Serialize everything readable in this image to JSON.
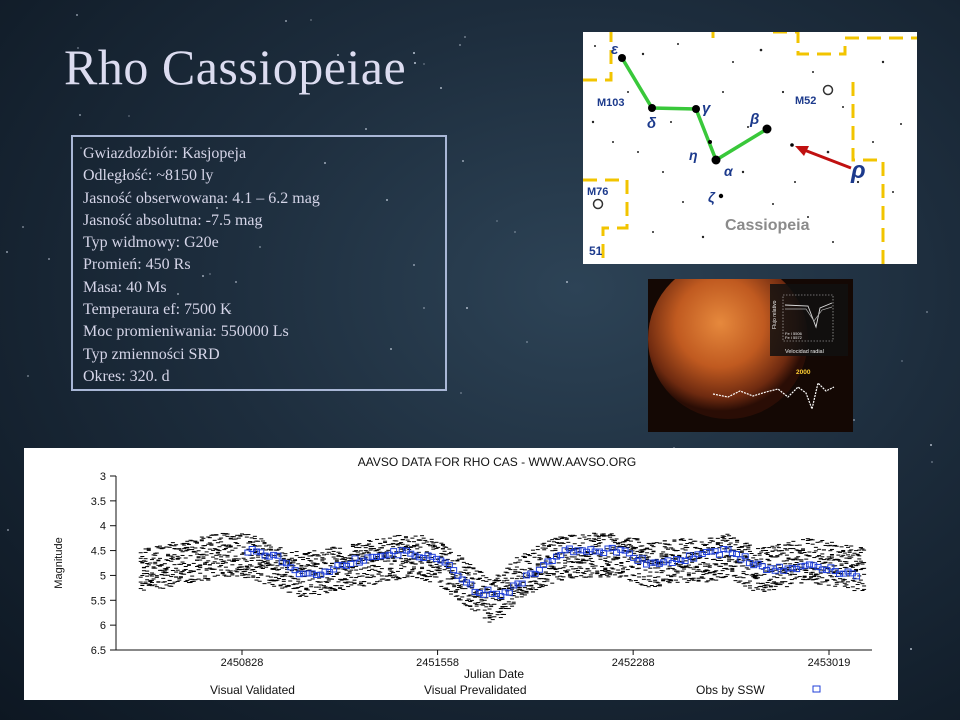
{
  "title": "Rho Cassiopeiae",
  "info_lines": [
    "Gwiazdozbiór: Kasjopeja",
    "Odległość: ~8150 ly",
    "Jasność obserwowana: 4.1 – 6.2 mag",
    "Jasność absolutna: -7.5 mag",
    "Typ widmowy: G20e",
    "Promień: 450 Rs",
    "Masa: 40 Ms",
    "Temperaura ef: 7500 K",
    "Moc promieniwania: 550000 Ls",
    "Typ zmienności SRD",
    "Okres: 320. d"
  ],
  "starmap": {
    "labels": {
      "epsilon": "ε",
      "delta": "δ",
      "gamma": "γ",
      "eta": "η",
      "alpha": "α",
      "zeta": "ζ",
      "beta": "β",
      "rho": "ρ"
    },
    "m103": "M103",
    "m52": "M52",
    "m76": "M76",
    "num51": "51",
    "constellation": "Cassiopeia"
  },
  "photo": {
    "y_label": "Flujo relativo",
    "legend": [
      "Fe I 5506",
      "Fe I 5572"
    ],
    "x_label": "Velocidad radial",
    "year": "2000"
  },
  "lightcurve": {
    "title": "AAVSO DATA FOR RHO CAS - WWW.AAVSO.ORG",
    "ylabel": "Magnitude",
    "xlabel": "Julian Date",
    "yticks": [
      "3",
      "3.5",
      "4",
      "4.5",
      "5",
      "5.5",
      "6",
      "6.5"
    ],
    "xticks": [
      "2450828",
      "2451558",
      "2452288",
      "2453019"
    ],
    "legend": [
      "Visual Validated",
      "Visual Prevalidated",
      "Obs by SSW"
    ],
    "colors": {
      "validated": "#000000",
      "ssw": "#1f3fd8"
    }
  },
  "chart_data": {
    "type": "scatter",
    "title": "AAVSO DATA FOR RHO CAS - WWW.AAVSO.ORG",
    "xlabel": "Julian Date",
    "ylabel": "Magnitude",
    "ylim": [
      6.5,
      3
    ],
    "y_inverted": true,
    "xticks": [
      2450828,
      2451558,
      2452288,
      2453019
    ],
    "series": [
      {
        "name": "Visual Validated",
        "x": [
          2450450,
          2450550,
          2450650,
          2450750,
          2450850,
          2450950,
          2451050,
          2451150,
          2451250,
          2451350,
          2451450,
          2451550,
          2451650,
          2451700,
          2451750,
          2451800,
          2451850,
          2451950,
          2452050,
          2452150,
          2452250,
          2452350,
          2452450,
          2452550,
          2452650,
          2452750,
          2452850,
          2452950,
          2453050,
          2453150
        ],
        "y": [
          4.9,
          4.8,
          4.7,
          4.6,
          4.6,
          4.8,
          5.0,
          4.9,
          4.8,
          4.7,
          4.6,
          4.7,
          5.1,
          5.3,
          5.5,
          5.4,
          5.1,
          4.8,
          4.6,
          4.6,
          4.6,
          4.8,
          4.7,
          4.7,
          4.6,
          4.9,
          4.8,
          4.7,
          4.8,
          4.9
        ]
      },
      {
        "name": "Obs by SSW",
        "x": [
          2450850,
          2450950,
          2451050,
          2451150,
          2451250,
          2451350,
          2451450,
          2451600,
          2451700,
          2451800,
          2451950,
          2452050,
          2452150,
          2452250,
          2452350,
          2452450,
          2452550,
          2452650,
          2452750,
          2452850,
          2452950,
          2453050,
          2453130
        ],
        "y": [
          4.5,
          4.6,
          5.0,
          4.9,
          4.7,
          4.6,
          4.5,
          4.8,
          5.3,
          5.4,
          4.8,
          4.5,
          4.5,
          4.5,
          4.8,
          4.7,
          4.6,
          4.5,
          4.8,
          4.9,
          4.8,
          4.9,
          5.0
        ]
      }
    ]
  }
}
